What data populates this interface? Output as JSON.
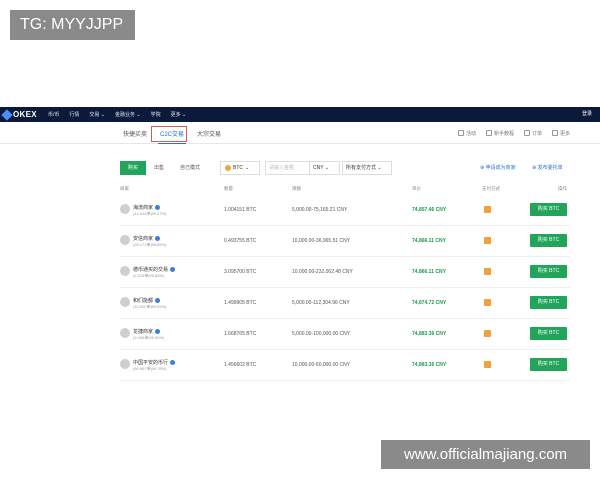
{
  "watermarks": {
    "top": "TG: MYYJJPP",
    "bottom": "www.officialmajiang.com"
  },
  "topnav": {
    "logo": "OKEX",
    "items": [
      "币/币",
      "行情",
      "交易 ⌄",
      "金融业务 ⌄",
      "学院",
      "更多 ⌄"
    ],
    "login": "登录"
  },
  "subnav": {
    "tabs": [
      "快捷买卖",
      "C2C交易",
      "大宗交易"
    ],
    "active_tab": "C2C交易",
    "right": [
      "活动",
      "新手教程",
      "订单",
      "更多"
    ]
  },
  "filter": {
    "buy": "购买",
    "sell": "出售",
    "mode": "自己模式",
    "coin": "BTC",
    "amount_placeholder": "请输入金额",
    "currency": "CNY",
    "payment": "所有支付方式",
    "merchant_link": "申请成为商家",
    "post_link": "发布委托单"
  },
  "table": {
    "headers": [
      "商家",
      "数量",
      "限额",
      "单价",
      "支付方式",
      "操作"
    ],
    "rows": [
      {
        "name": "海流商家",
        "stats": "(14,034单|99.27%)",
        "qty": "1.004151 BTC",
        "limit": "5,000.00-75,165.21 CNY",
        "price": "74,857.46 CNY",
        "action": "购买 BTC"
      },
      {
        "name": "安信商家",
        "stats": "(25,171单|99.66%)",
        "qty": "0.493755 BTC",
        "limit": "10,000.00-36,965.51 CNY",
        "price": "74,866.11 CNY",
        "action": "购买 BTC"
      },
      {
        "name": "德币通买的交易",
        "stats": "(2,515单|99.83%)",
        "qty": "3.095700 BTC",
        "limit": "10,000.00-232,062.48 CNY",
        "price": "74,866.11 CNY",
        "action": "购买 BTC"
      },
      {
        "name": "和们能都",
        "stats": "(10,000单|99.59%)",
        "qty": "1.499905 BTC",
        "limit": "5,000.00-112,304.96 CNY",
        "price": "74,874.72 CNY",
        "action": "购买 BTC"
      },
      {
        "name": "龙捷商家",
        "stats": "(2,406单|99.30%)",
        "qty": "1.668765 BTC",
        "limit": "5,000.00-100,000.00 CNY",
        "price": "74,883.36 CNY",
        "action": "购买 BTC"
      },
      {
        "name": "中国平安的币行",
        "stats": "(60,957单|99.78%)",
        "qty": "1.456602 BTC",
        "limit": "10,000.00-60,000.00 CNY",
        "price": "74,883.36 CNY",
        "action": "购买 BTC"
      }
    ]
  },
  "colors": {
    "nav_bg": "#0b1a3a",
    "accent_green": "#22a55a",
    "link_blue": "#2a6ede",
    "highlight_red": "#e05a4a"
  }
}
